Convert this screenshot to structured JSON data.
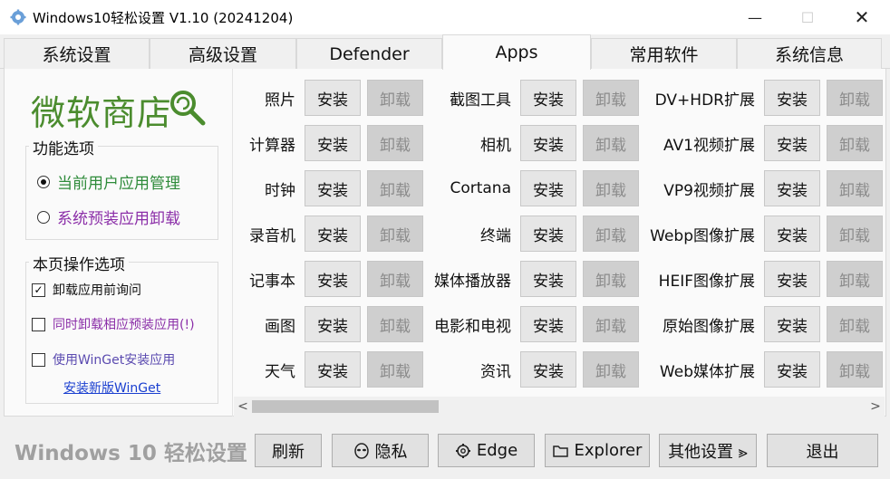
{
  "window": {
    "title": "Windows10轻松设置 V1.10  (20241204)",
    "min_glyph": "—",
    "max_glyph": "☐",
    "close_glyph": "✕"
  },
  "tabs": [
    {
      "label": "系统设置",
      "active": false
    },
    {
      "label": "高级设置",
      "active": false
    },
    {
      "label": "Defender",
      "active": false
    },
    {
      "label": "Apps",
      "active": true
    },
    {
      "label": "常用软件",
      "active": false
    },
    {
      "label": "系统信息",
      "active": false
    }
  ],
  "sidebar": {
    "logo_text": "微软商店",
    "logo_icon": "lollipop-search-icon",
    "feature_group": {
      "title": "功能选项",
      "options": [
        {
          "label": "当前用户应用管理",
          "checked": true,
          "color": "#2e8b3a"
        },
        {
          "label": "系统预装应用卸载",
          "checked": false,
          "color": "#8b2ea8"
        }
      ]
    },
    "page_group": {
      "title": "本页操作选项",
      "checks": [
        {
          "label": "卸载应用前询问",
          "checked": true,
          "color": "#111111"
        },
        {
          "label": "同时卸载相应预装应用(!)",
          "checked": false,
          "color": "#8b2ea8"
        },
        {
          "label": "使用WinGet安装应用",
          "checked": false,
          "color": "#5b4bb0"
        }
      ],
      "link": "安装新版WinGet"
    }
  },
  "buttons": {
    "install": "安装",
    "uninstall": "卸载"
  },
  "apps": {
    "col1": [
      "照片",
      "计算器",
      "时钟",
      "录音机",
      "记事本",
      "画图",
      "天气"
    ],
    "col2": [
      "截图工具",
      "相机",
      "Cortana",
      "终端",
      "媒体播放器",
      "电影和电视",
      "资讯"
    ],
    "col3": [
      "DV+HDR扩展",
      "AV1视频扩展",
      "VP9视频扩展",
      "Webp图像扩展",
      "HEIF图像扩展",
      "原始图像扩展",
      "Web媒体扩展"
    ]
  },
  "scrollbar": {
    "left_glyph": "<",
    "right_glyph": ">"
  },
  "bottom": {
    "brand": "Windows 10 轻松设置",
    "refresh": "刷新",
    "privacy": "隐私",
    "edge": "Edge",
    "explorer": "Explorer",
    "other": "其他设置 ⪢",
    "exit": "退出"
  },
  "colors": {
    "logo": "#4b8c2e",
    "link": "#1a3fd0"
  }
}
